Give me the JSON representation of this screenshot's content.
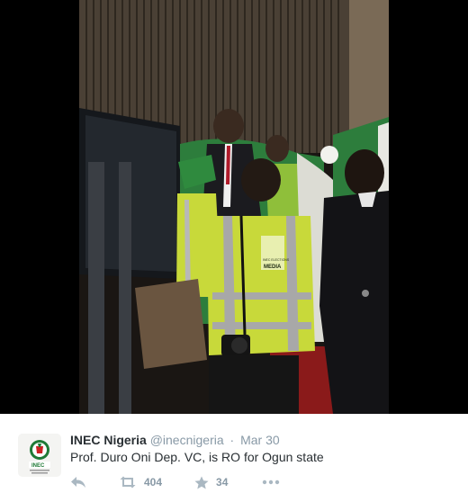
{
  "tweet": {
    "author_name": "INEC Nigeria",
    "author_handle": "@inecnigeria",
    "separator": "·",
    "timestamp": "Mar 30",
    "text": "Prof. Duro Oni Dep. VC, is RO for Ogun state",
    "retweet_count": "404",
    "like_count": "34"
  },
  "media": {
    "vest_label": "MEDIA",
    "vest_sublabel": "INEC ELECTIONS"
  },
  "avatar": {
    "logo_text": "INEC"
  },
  "icons": {
    "reply": "reply-icon",
    "retweet": "retweet-icon",
    "like": "star-icon",
    "more": "more-dots-icon"
  },
  "colors": {
    "name": "#292f33",
    "meta": "#8899a6",
    "vest": "#c8d93a",
    "stage_green": "#2d7d3c"
  }
}
